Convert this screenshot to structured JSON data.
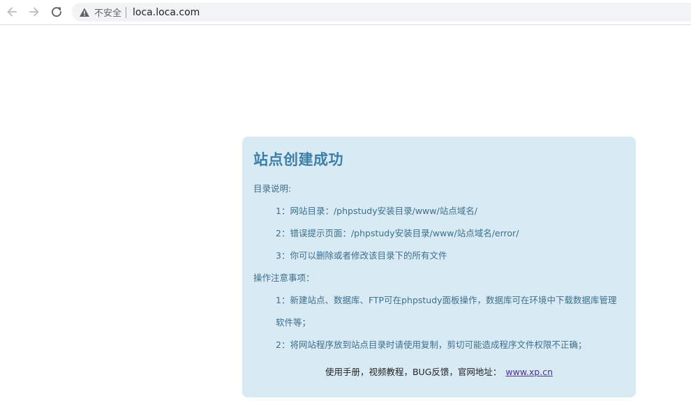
{
  "browser": {
    "security_label": "不安全",
    "url": "loca.loca.com"
  },
  "card": {
    "title": "站点创建成功",
    "dir_heading": "目录说明:",
    "dir_items": [
      "1：网站目录：/phpstudy安装目录/www/站点域名/",
      "2：错误提示页面：/phpstudy安装目录/www/站点域名/error/",
      "3：你可以删除或者修改该目录下的所有文件"
    ],
    "notes_heading": "操作注意事项：",
    "notes_items": [
      "1：新建站点、数据库、FTP可在phpstudy面板操作，数据库可在环境中下载数据库管理",
      "软件等；",
      "2：将网站程序放到站点目录时请使用复制，剪切可能造成程序文件权限不正确；"
    ],
    "footer_text": "使用手册，视频教程，BUG反馈，官网地址：",
    "footer_link": "www.xp.cn"
  },
  "colors": {
    "card_bg": "#d8ebf4",
    "title": "#3c7ea6",
    "text": "#3d6e8d",
    "link": "#4b2f8f"
  },
  "icons": [
    "arrow-back-icon",
    "arrow-forward-icon",
    "reload-icon",
    "warning-icon"
  ]
}
